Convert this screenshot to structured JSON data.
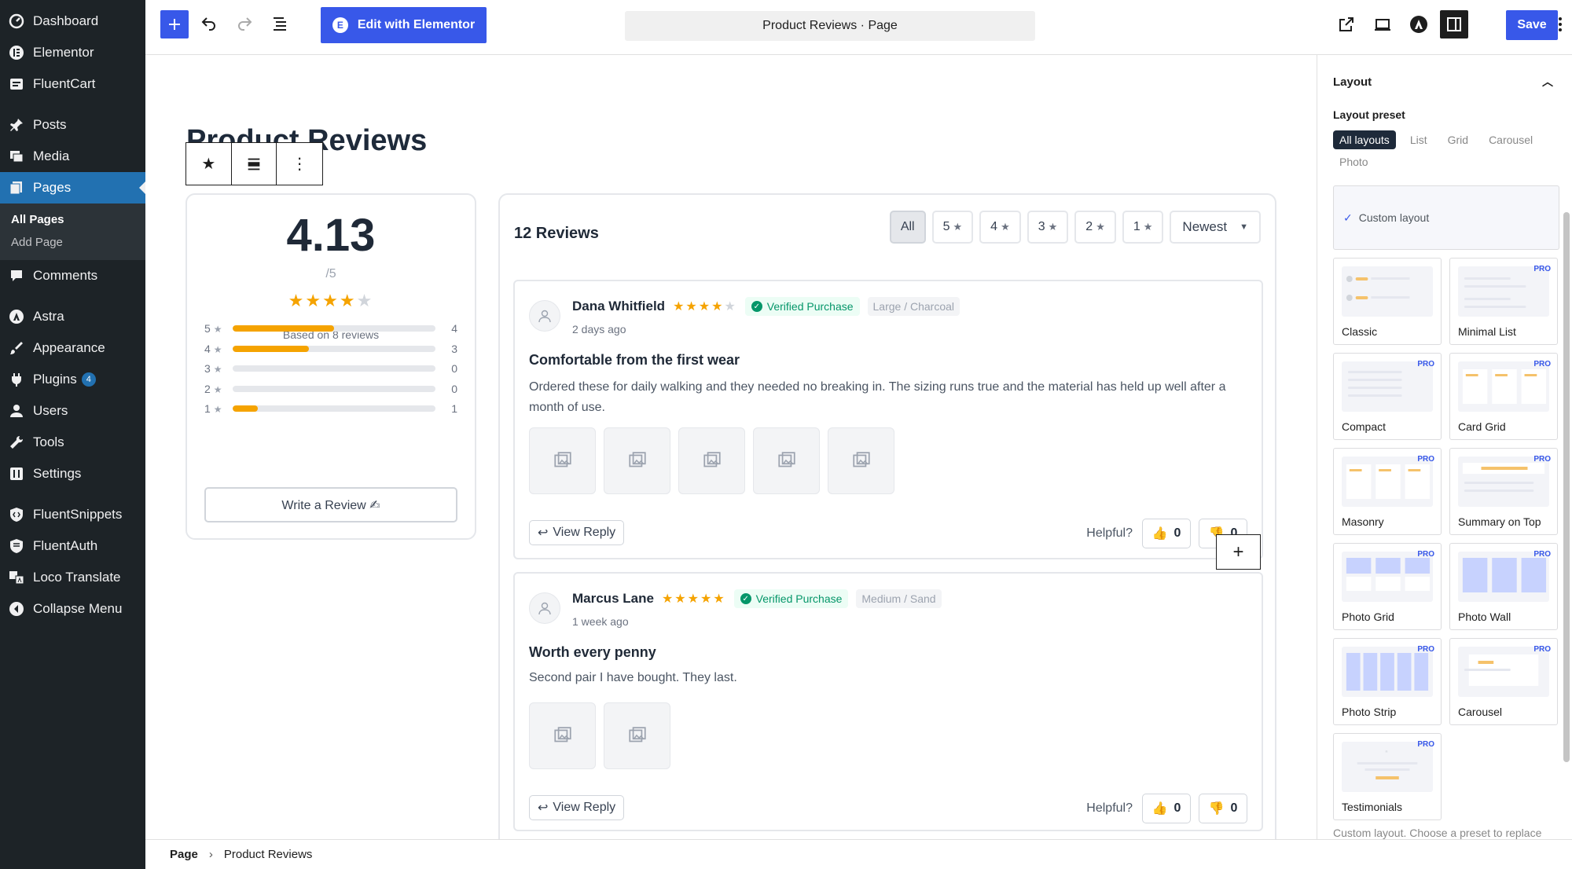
{
  "wp_sidebar": {
    "items": [
      {
        "label": "Dashboard",
        "icon": "dashboard-icon"
      },
      {
        "label": "Elementor",
        "icon": "elementor-icon"
      },
      {
        "label": "FluentCart",
        "icon": "cart-icon"
      },
      {
        "label": "Posts",
        "icon": "pin-icon"
      },
      {
        "label": "Media",
        "icon": "media-icon"
      },
      {
        "label": "Pages",
        "icon": "pages-icon"
      },
      {
        "label": "Comments",
        "icon": "comments-icon"
      },
      {
        "label": "Astra",
        "icon": "astra-icon"
      },
      {
        "label": "Appearance",
        "icon": "brush-icon"
      },
      {
        "label": "Plugins",
        "icon": "plug-icon",
        "badge": "4"
      },
      {
        "label": "Users",
        "icon": "users-icon"
      },
      {
        "label": "Tools",
        "icon": "wrench-icon"
      },
      {
        "label": "Settings",
        "icon": "settings-icon"
      },
      {
        "label": "FluentSnippets",
        "icon": "snippets-icon"
      },
      {
        "label": "FluentAuth",
        "icon": "shield-icon"
      },
      {
        "label": "Loco Translate",
        "icon": "translate-icon"
      },
      {
        "label": "Collapse Menu",
        "icon": "collapse-icon"
      }
    ],
    "pages_sub": [
      "All Pages",
      "Add Page"
    ]
  },
  "topbar": {
    "elementor_label": "Edit with Elementor",
    "doc_title": "Product Reviews · Page",
    "save_label": "Save"
  },
  "canvas": {
    "page_title": "Product Reviews"
  },
  "summary": {
    "average": "4.13",
    "out_of": "/5",
    "rating_fraction": 0.826,
    "based_on": "Based on 8 reviews",
    "distribution": [
      {
        "star": "5",
        "count": "4",
        "fraction": 0.5
      },
      {
        "star": "4",
        "count": "3",
        "fraction": 0.375
      },
      {
        "star": "3",
        "count": "0",
        "fraction": 0
      },
      {
        "star": "2",
        "count": "0",
        "fraction": 0
      },
      {
        "star": "1",
        "count": "1",
        "fraction": 0.125
      }
    ],
    "write_review": "Write a Review ✍"
  },
  "reviews": {
    "count_label": "12 Reviews",
    "filters": [
      "All",
      "5",
      "4",
      "3",
      "2",
      "1"
    ],
    "sort": "Newest",
    "helpful_label": "Helpful?",
    "view_reply": "View Reply",
    "items": [
      {
        "name": "Dana Whitfield",
        "rating": 4,
        "verified": "Verified Purchase",
        "variant": "Large / Charcoal",
        "time": "2 days ago",
        "title": "Comfortable from the first wear",
        "body": "Ordered these for daily walking and they needed no breaking in. The sizing runs true and the material has held up well after a month of use.",
        "images": 5,
        "up": "0",
        "down": "0"
      },
      {
        "name": "Marcus Lane",
        "rating": 5,
        "verified": "Verified Purchase",
        "variant": "Medium / Sand",
        "time": "1 week ago",
        "title": "Worth every penny",
        "body": "Second pair I have bought. They last.",
        "images": 2,
        "up": "0",
        "down": "0"
      }
    ]
  },
  "breadcrumb": {
    "root": "Page",
    "current": "Product Reviews"
  },
  "settings": {
    "section": "Layout",
    "preset_label": "Layout preset",
    "preset_tabs": [
      "All layouts",
      "List",
      "Grid",
      "Carousel",
      "Photo"
    ],
    "custom_layout": "Custom layout",
    "pro_label": "PRO",
    "layouts": [
      {
        "name": "Classic",
        "pro": false
      },
      {
        "name": "Minimal List",
        "pro": true
      },
      {
        "name": "Compact",
        "pro": true
      },
      {
        "name": "Card Grid",
        "pro": true
      },
      {
        "name": "Masonry",
        "pro": true
      },
      {
        "name": "Summary on Top",
        "pro": true
      },
      {
        "name": "Photo Grid",
        "pro": true
      },
      {
        "name": "Photo Wall",
        "pro": true
      },
      {
        "name": "Photo Strip",
        "pro": true
      },
      {
        "name": "Carousel",
        "pro": true
      },
      {
        "name": "Testimonials",
        "pro": true
      }
    ],
    "note": "Custom layout. Choose a preset to replace"
  },
  "colors": {
    "accent": "#3858e9",
    "star": "#f5a300",
    "verified": "#059669",
    "wp_sidebar": "#1d2327",
    "wp_active": "#2271b1"
  }
}
